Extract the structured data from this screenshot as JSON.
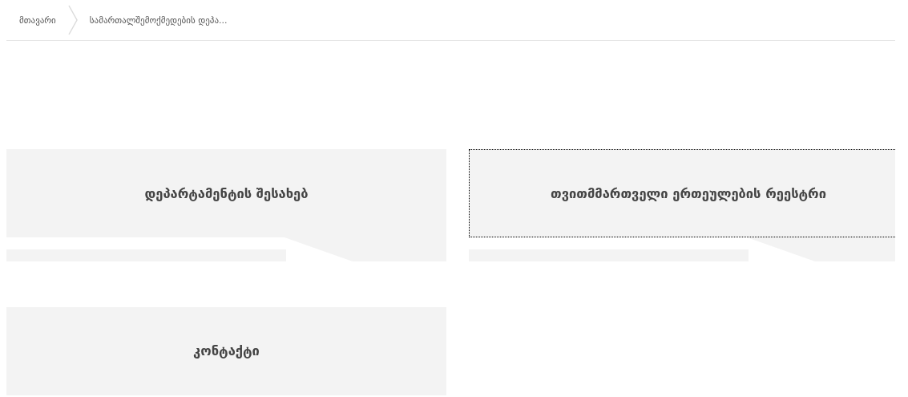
{
  "breadcrumb": [
    {
      "label": "მთავარი"
    },
    {
      "label": "სამართალშემოქმედების დეპა..."
    }
  ],
  "tiles": [
    {
      "title": "დეპარტამენტის შესახებ",
      "focused": false
    },
    {
      "title": "თვითმმართველი ერთეულების რეესტრი",
      "focused": true
    },
    {
      "title": "კონტაქტი",
      "focused": false
    }
  ]
}
